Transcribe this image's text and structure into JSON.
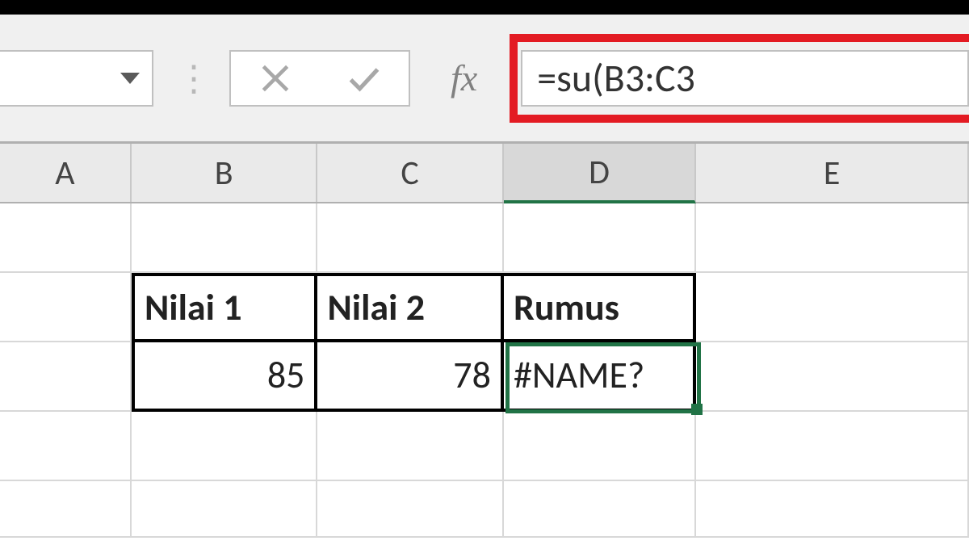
{
  "formula_bar": {
    "name_box_value": "",
    "fx_label": "fx",
    "formula_text": "=su(B3:C3"
  },
  "columns": [
    "A",
    "B",
    "C",
    "D",
    "E"
  ],
  "selected_column": "D",
  "selected_cell": "D3",
  "table": {
    "headers": {
      "b2": "Nilai 1",
      "c2": "Nilai 2",
      "d2": "Rumus"
    },
    "values": {
      "b3": "85",
      "c3": "78",
      "d3": "#NAME?"
    }
  },
  "colors": {
    "excel_green": "#217346",
    "highlight_red": "#e31b23"
  }
}
